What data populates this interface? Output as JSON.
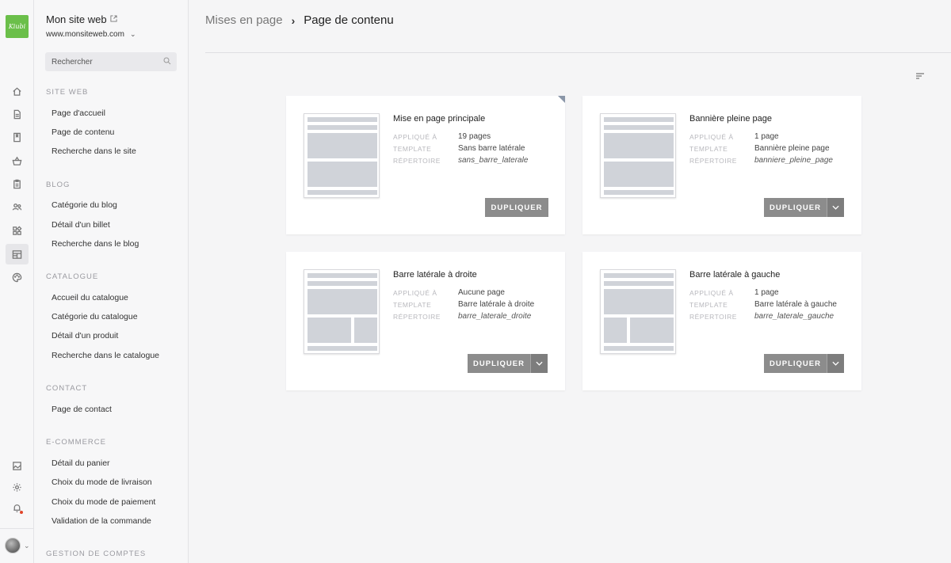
{
  "logo": {
    "text": "Kiubi"
  },
  "site": {
    "name": "Mon site web",
    "url": "www.monsiteweb.com"
  },
  "search": {
    "placeholder": "Rechercher"
  },
  "sidebar": {
    "sections": [
      {
        "title": "SITE WEB",
        "items": [
          "Page d'accueil",
          "Page de contenu",
          "Recherche dans le site"
        ]
      },
      {
        "title": "BLOG",
        "items": [
          "Catégorie du blog",
          "Détail d'un billet",
          "Recherche dans le blog"
        ]
      },
      {
        "title": "CATALOGUE",
        "items": [
          "Accueil du catalogue",
          "Catégorie du catalogue",
          "Détail d'un produit",
          "Recherche dans le catalogue"
        ]
      },
      {
        "title": "CONTACT",
        "items": [
          "Page de contact"
        ]
      },
      {
        "title": "E-COMMERCE",
        "items": [
          "Détail du panier",
          "Choix du mode de livraison",
          "Choix du mode de paiement",
          "Validation de la commande"
        ]
      },
      {
        "title": "GESTION DE COMPTES",
        "items": []
      }
    ]
  },
  "breadcrumb": {
    "parent": "Mises en page",
    "separator": "›",
    "current": "Page de contenu"
  },
  "labels": {
    "applied": "APPLIQUÉ À",
    "template": "TEMPLATE",
    "directory": "RÉPERTOIRE"
  },
  "cards": [
    {
      "title": "Mise en page principale",
      "applied": "19 pages",
      "template": "Sans barre latérale",
      "directory": "sans_barre_laterale",
      "button": "DUPLIQUER"
    },
    {
      "title": "Bannière pleine page",
      "applied": "1 page",
      "template": "Bannière pleine page",
      "directory": "banniere_pleine_page",
      "button": "DUPLIQUER"
    },
    {
      "title": "Barre latérale à droite",
      "applied": "Aucune page",
      "template": "Barre latérale à droite",
      "directory": "barre_laterale_droite",
      "button": "DUPLIQUER"
    },
    {
      "title": "Barre latérale à gauche",
      "applied": "1 page",
      "template": "Barre latérale à gauche",
      "directory": "barre_laterale_gauche",
      "button": "DUPLIQUER"
    }
  ],
  "colors": {
    "brand": "#6bbf4a",
    "button": "#8c8c8c",
    "notification": "#e0452a"
  },
  "icons": [
    "home-icon",
    "page-icon",
    "book-icon",
    "basket-icon",
    "clipboard-icon",
    "users-icon",
    "modules-icon",
    "layout-icon",
    "palette-icon",
    "media-icon",
    "gear-icon",
    "bell-icon",
    "sort-icon",
    "search-icon",
    "external-link-icon",
    "chevron-down-icon"
  ]
}
